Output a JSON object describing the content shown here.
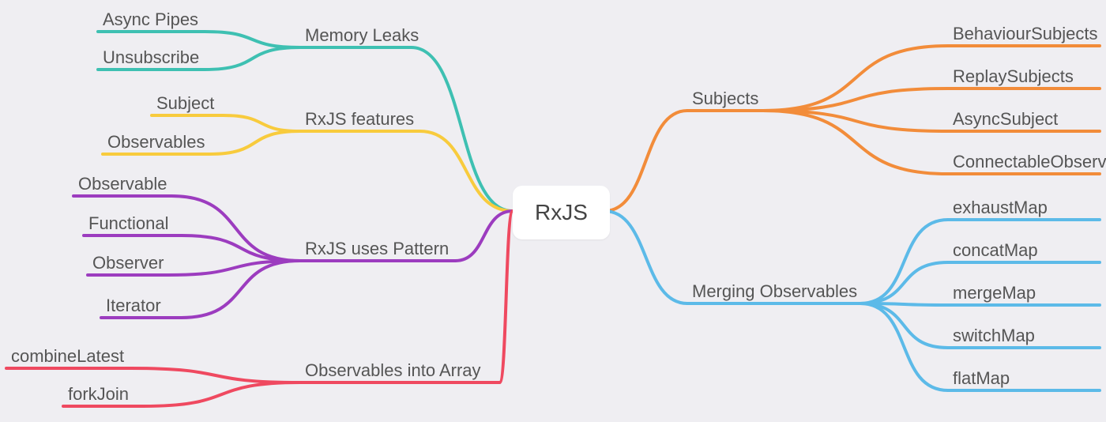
{
  "root": "RxJS",
  "colors": {
    "teal": "#3ec0b2",
    "yellow": "#f8cb3d",
    "purple": "#9c3cbf",
    "red": "#ef4960",
    "orange": "#f28c3a",
    "blue": "#5cbae8"
  },
  "left": [
    {
      "label": "Memory Leaks",
      "colorKey": "teal",
      "children": [
        "Async Pipes",
        "Unsubscribe"
      ]
    },
    {
      "label": "RxJS features",
      "colorKey": "yellow",
      "children": [
        "Subject",
        "Observables"
      ]
    },
    {
      "label": "RxJS uses Pattern",
      "colorKey": "purple",
      "children": [
        "Observable",
        "Functional",
        "Observer",
        "Iterator"
      ]
    },
    {
      "label": "Observables into Array",
      "colorKey": "red",
      "children": [
        "combineLatest",
        "forkJoin"
      ]
    }
  ],
  "right": [
    {
      "label": "Subjects",
      "colorKey": "orange",
      "children": [
        "BehaviourSubjects",
        "ReplaySubjects",
        "AsyncSubject",
        "ConnectableObservable"
      ]
    },
    {
      "label": "Merging Observables",
      "colorKey": "blue",
      "children": [
        "exhaustMap",
        "concatMap",
        "mergeMap",
        "switchMap",
        "flatMap"
      ]
    }
  ]
}
